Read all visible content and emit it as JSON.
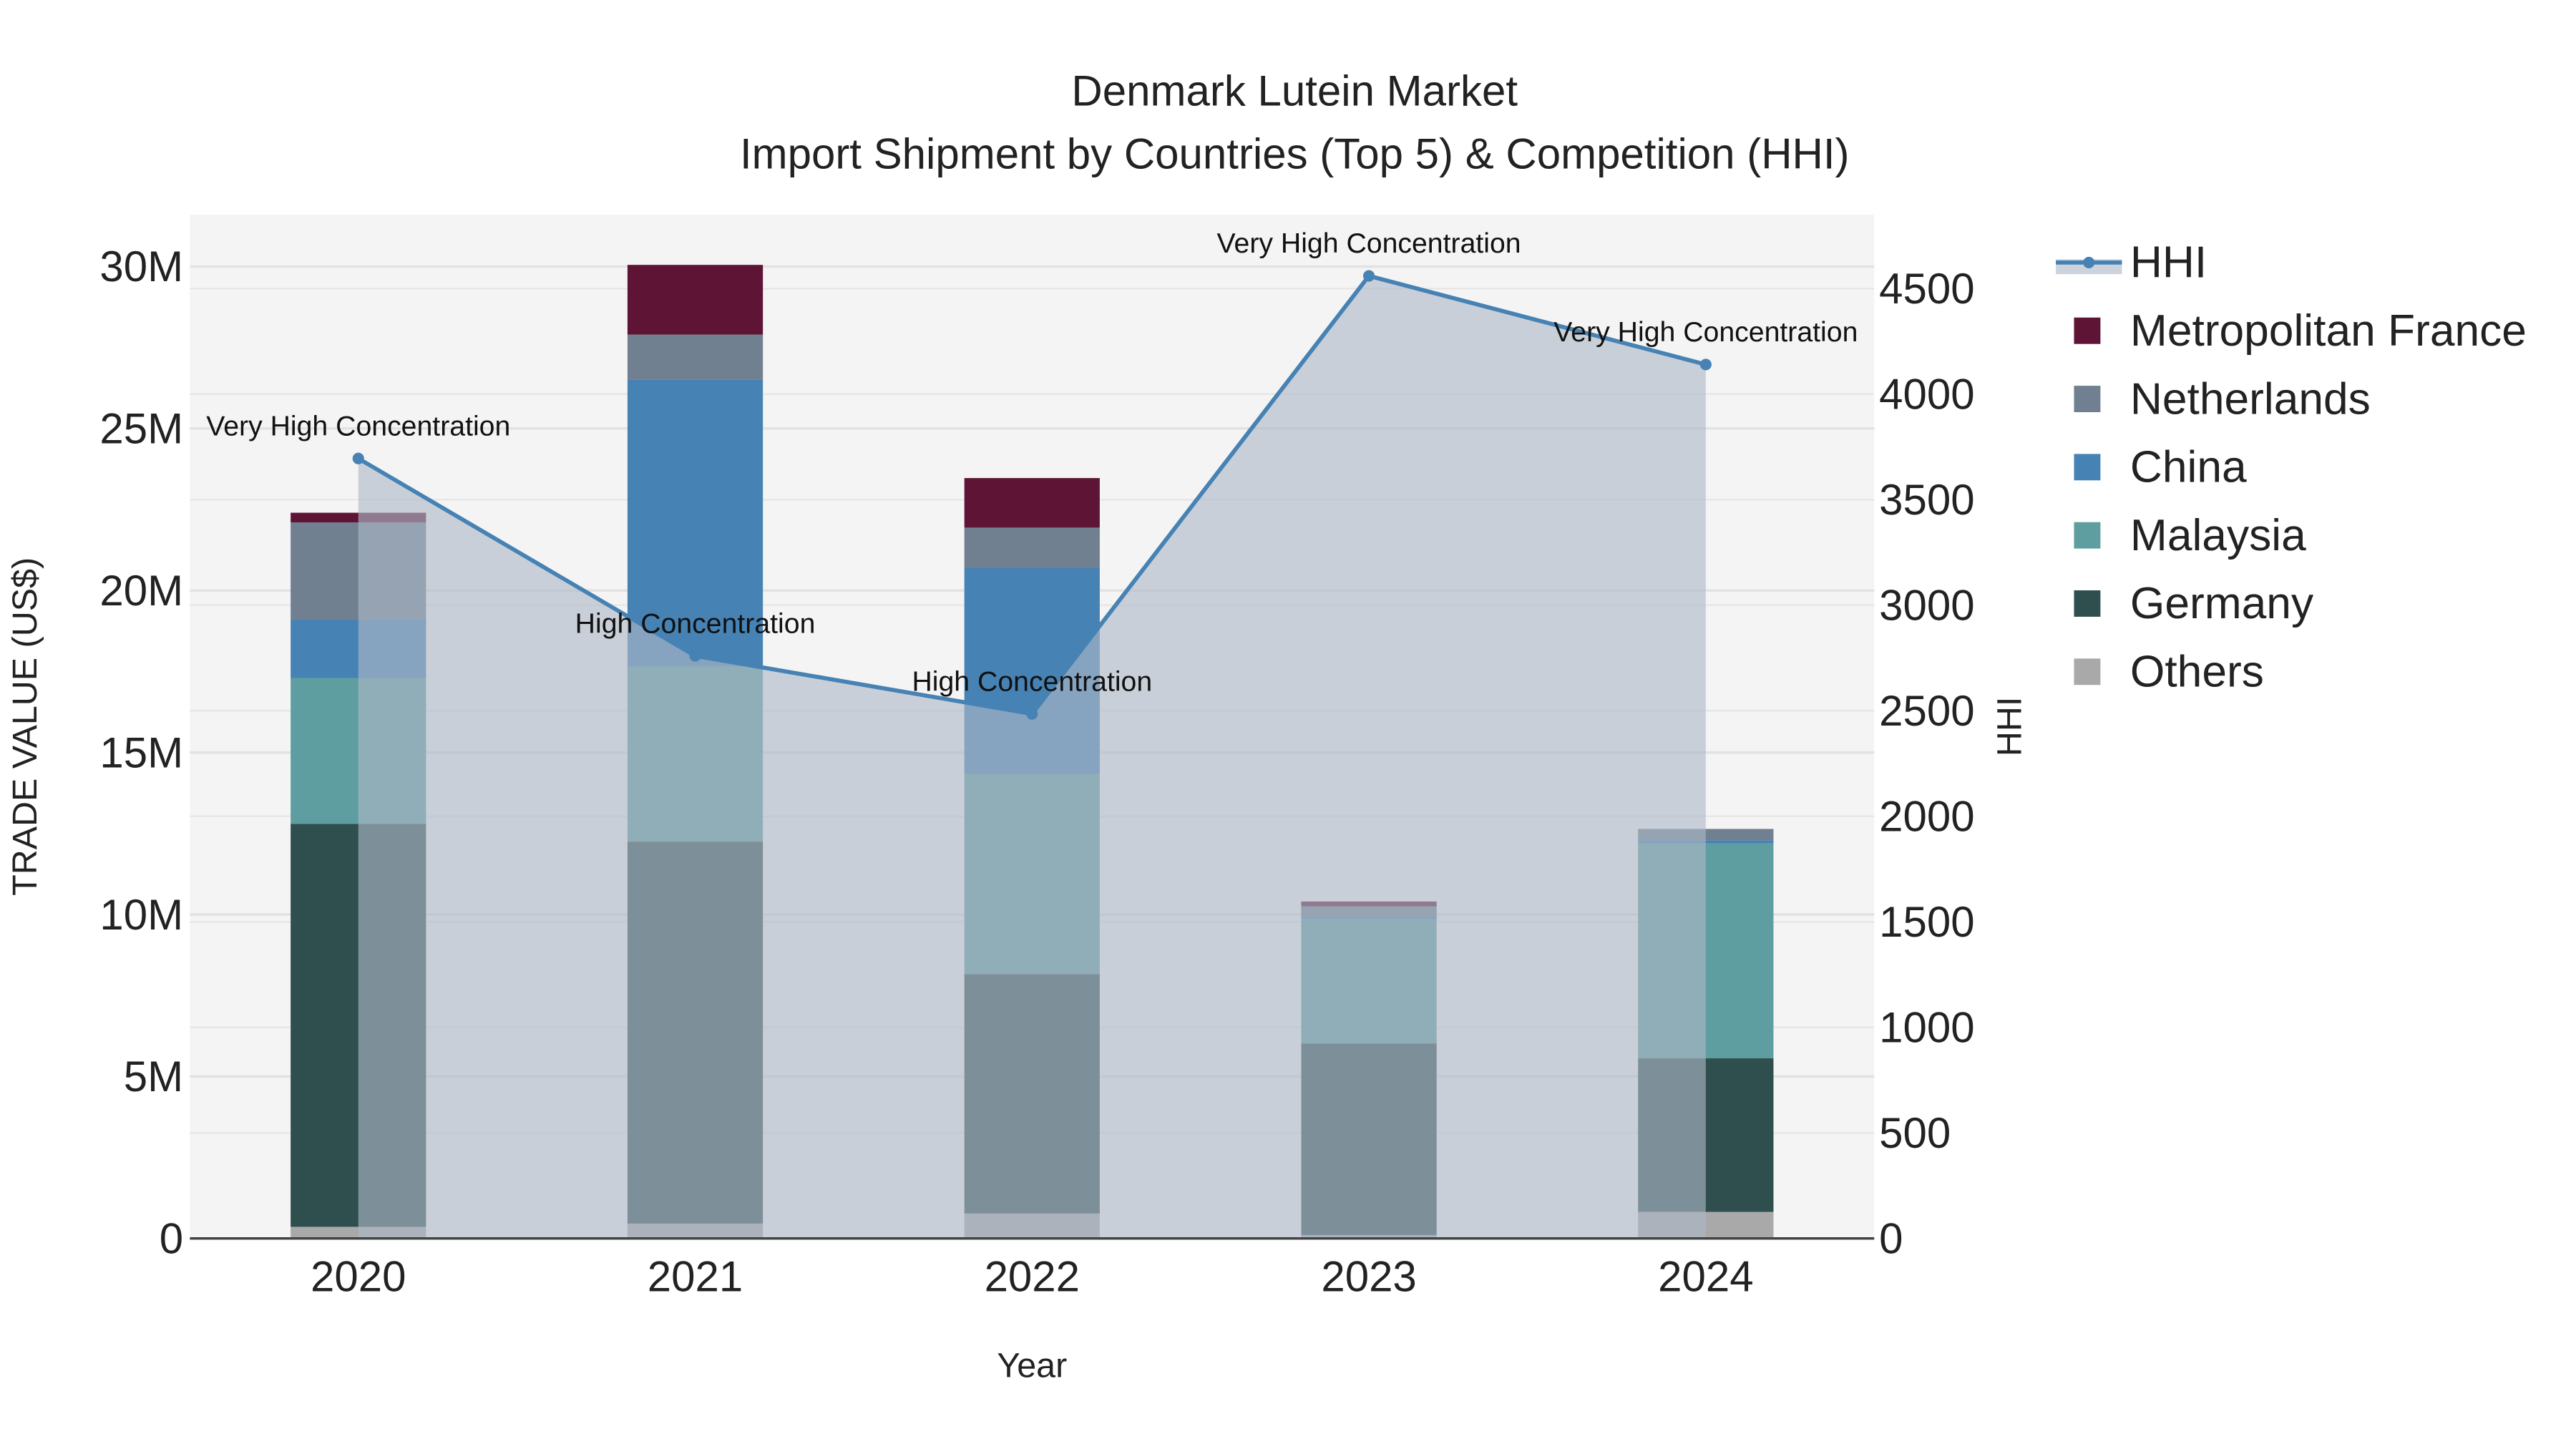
{
  "chart_data": {
    "type": "bar",
    "title": "Denmark Lutein Market",
    "subtitle": "Import Shipment by Countries (Top 5) & Competition (HHI)",
    "xlabel": "Year",
    "ylabel": "TRADE VALUE (US$)",
    "y2label": "HHI",
    "categories": [
      "2020",
      "2021",
      "2022",
      "2023",
      "2024"
    ],
    "ylim": [
      0,
      31600000
    ],
    "y2lim": [
      0,
      4850
    ],
    "yticks": [
      0,
      5000000,
      10000000,
      15000000,
      20000000,
      25000000,
      30000000
    ],
    "ytick_labels": [
      "0",
      "5M",
      "10M",
      "15M",
      "20M",
      "25M",
      "30M"
    ],
    "y2ticks": [
      0,
      500,
      1000,
      1500,
      2000,
      2500,
      3000,
      3500,
      4000,
      4500
    ],
    "y2tick_labels": [
      "0",
      "500",
      "1000",
      "1500",
      "2000",
      "2500",
      "3000",
      "3500",
      "4000",
      "4500"
    ],
    "legend_position": "right",
    "series": [
      {
        "name": "Others",
        "color": "#a9a9a9",
        "values": [
          360000,
          460000,
          770000,
          100000,
          820000
        ]
      },
      {
        "name": "Germany",
        "color": "#2f4f4f",
        "values": [
          12440000,
          11790000,
          7390000,
          5920000,
          4740000
        ]
      },
      {
        "name": "Malaysia",
        "color": "#5f9ea0",
        "values": [
          4500000,
          5400000,
          6180000,
          3830000,
          6630000
        ]
      },
      {
        "name": "China",
        "color": "#4682b4",
        "values": [
          1800000,
          8850000,
          6360000,
          50000,
          100000
        ]
      },
      {
        "name": "Netherlands",
        "color": "#708090",
        "values": [
          3000000,
          1400000,
          1240000,
          350000,
          350000
        ]
      },
      {
        "name": "Metropolitan France",
        "color": "#5e1535",
        "values": [
          300000,
          2150000,
          1530000,
          150000,
          0
        ]
      }
    ],
    "hhi": {
      "name": "HHI",
      "color": "#4682b4",
      "values": [
        3695,
        2760,
        2485,
        4560,
        4140
      ],
      "annotations": [
        "Very High Concentration",
        "High Concentration",
        "High Concentration",
        "Very High Concentration",
        "Very High Concentration"
      ]
    },
    "legend_order": [
      "HHI",
      "Metropolitan France",
      "Netherlands",
      "China",
      "Malaysia",
      "Germany",
      "Others"
    ]
  }
}
